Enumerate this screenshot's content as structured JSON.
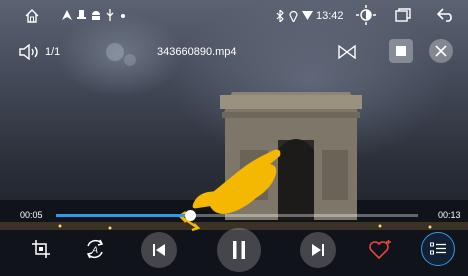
{
  "status_bar": {
    "time": "13:42",
    "left_icons": [
      "home-icon",
      "navigation-arrow-icon",
      "notification-icon",
      "android-icon",
      "usb-icon",
      "dot-icon"
    ],
    "right_icons": [
      "bluetooth-icon",
      "location-icon",
      "wifi-icon",
      "brightness-icon",
      "window-icon",
      "back-arrow-icon"
    ]
  },
  "player": {
    "playlist_position": "1/1",
    "file_name": "343660890.mp4",
    "elapsed": "00:05",
    "duration": "00:13",
    "progress_fraction": 0.37
  },
  "colors": {
    "accent": "#2f9be8",
    "favorite": "#e8453c",
    "gesture_hand": "#f5b800"
  },
  "controls": {
    "top_icons": [
      "volume-icon",
      "bowtie-icon",
      "window-mode-icon",
      "close-icon"
    ],
    "bottom_icons": [
      "crop-icon",
      "auto-rotate-icon",
      "previous-icon",
      "pause-icon",
      "next-icon",
      "favorite-icon",
      "playlist-icon"
    ]
  }
}
